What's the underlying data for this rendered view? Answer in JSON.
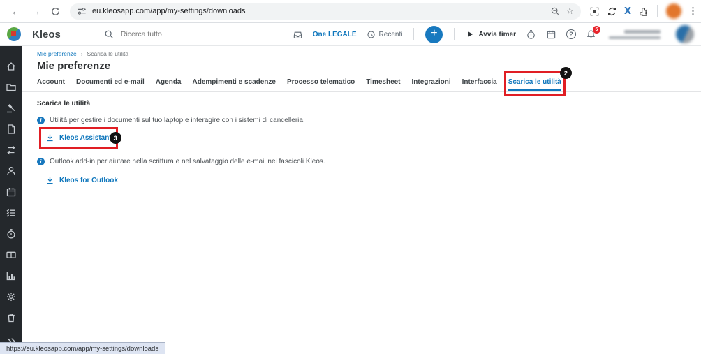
{
  "browser": {
    "url": "eu.kleosapp.com/app/my-settings/downloads",
    "status_url": "https://eu.kleosapp.com/app/my-settings/downloads",
    "back": "←",
    "forward": "→",
    "menu_dots": "⋮",
    "star": "☆",
    "x_extension": "X"
  },
  "header": {
    "app_name": "Kleos",
    "search_placeholder": "Ricerca tutto",
    "one_legale_label": "One LEGALE",
    "recents_label": "Recenti",
    "start_timer_label": "Avvia timer",
    "plus_label": "+",
    "help_label": "?",
    "notification_count": "5"
  },
  "breadcrumb": {
    "parent": "Mie preferenze",
    "separator": "›",
    "current": "Scarica le utilità"
  },
  "page": {
    "title": "Mie preferenze"
  },
  "tabs": [
    {
      "label": "Account",
      "active": false
    },
    {
      "label": "Documenti ed e-mail",
      "active": false
    },
    {
      "label": "Agenda",
      "active": false
    },
    {
      "label": "Adempimenti e scadenze",
      "active": false
    },
    {
      "label": "Processo telematico",
      "active": false
    },
    {
      "label": "Timesheet",
      "active": false
    },
    {
      "label": "Integrazioni",
      "active": false
    },
    {
      "label": "Interfaccia",
      "active": false
    },
    {
      "label": "Scarica le utilità",
      "active": true
    }
  ],
  "content": {
    "section_title": "Scarica le utilità",
    "utilities": [
      {
        "info": "Utilità per gestire i documenti sul tuo laptop e interagire con i sistemi di cancelleria.",
        "link": "Kleos Assistant"
      },
      {
        "info": "Outlook add-in per aiutare nella scrittura e nel salvataggio delle e-mail nei fascicoli Kleos.",
        "link": "Kleos for Outlook"
      }
    ]
  },
  "annotations": {
    "step2": "2",
    "step3": "3"
  },
  "sidebar_icons": [
    "home",
    "folder",
    "gavel",
    "document",
    "swap-arrows",
    "user",
    "calendar",
    "tasks-checklist",
    "stopwatch",
    "cards",
    "bar-chart",
    "gear",
    "trash",
    "double-chevron"
  ],
  "colors": {
    "accent_blue": "#0e76bc",
    "annotation_red": "#e01e24",
    "sidebar_bg": "#24282c",
    "badge_black": "#121212",
    "notification_red": "#e8252d",
    "plus_button_blue": "#1879bf"
  }
}
